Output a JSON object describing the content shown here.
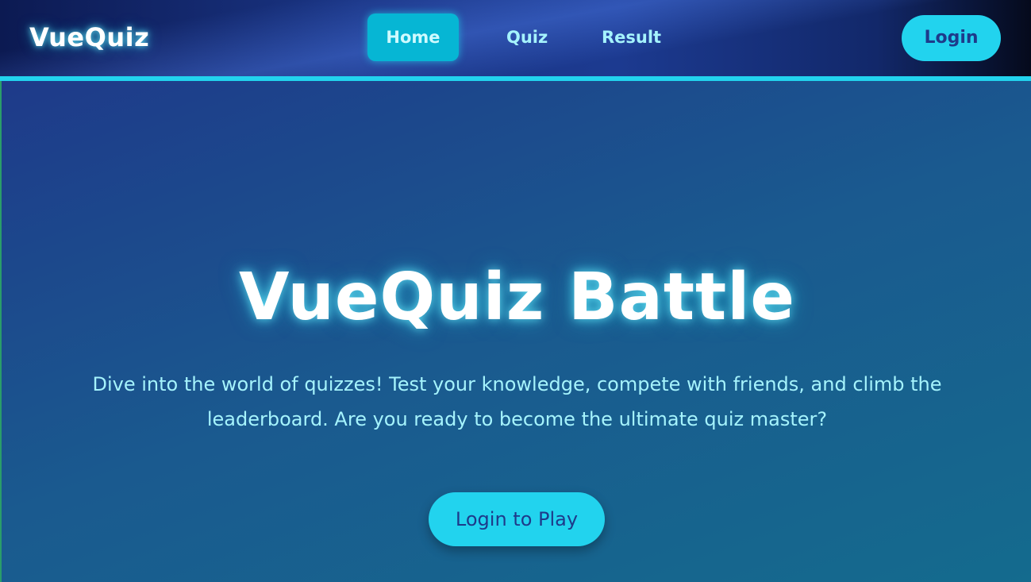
{
  "navbar": {
    "brand": "VueQuiz",
    "links": [
      {
        "label": "Home",
        "active": true
      },
      {
        "label": "Quiz",
        "active": false
      },
      {
        "label": "Result",
        "active": false
      }
    ],
    "login_label": "Login"
  },
  "hero": {
    "title": "VueQuiz Battle",
    "description": "Dive into the world of quizzes! Test your knowledge, compete with friends, and climb the leaderboard. Are you ready to become the ultimate quiz master?",
    "cta_label": "Login to Play"
  },
  "colors": {
    "accent": "#22d3ee",
    "active_nav": "#06b6d4",
    "text_light": "#a5f3fc",
    "button_text": "#1e3a8a",
    "background": "#1e3a8a"
  }
}
